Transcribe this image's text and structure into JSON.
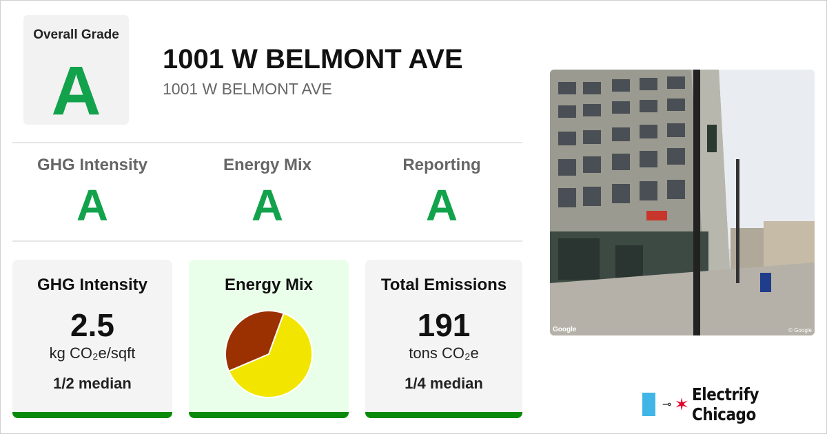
{
  "overall": {
    "label": "Overall Grade",
    "grade": "A"
  },
  "building": {
    "name": "1001 W BELMONT AVE",
    "address": "1001 W BELMONT AVE"
  },
  "subgrades": [
    {
      "label": "GHG Intensity",
      "grade": "A"
    },
    {
      "label": "Energy Mix",
      "grade": "A"
    },
    {
      "label": "Reporting",
      "grade": "A"
    }
  ],
  "cards": {
    "ghg": {
      "title": "GHG Intensity",
      "value": "2.5",
      "unit": "kg CO₂e/sqft",
      "median": "1/2 median"
    },
    "mix": {
      "title": "Energy Mix"
    },
    "emissions": {
      "title": "Total Emissions",
      "value": "191",
      "unit": "tons CO₂e",
      "median": "1/4 median"
    }
  },
  "chart_data": {
    "type": "pie",
    "title": "Energy Mix",
    "series": [
      {
        "value": 0.63,
        "color": "#f2e600"
      },
      {
        "value": 0.37,
        "color": "#9b3100"
      }
    ]
  },
  "photo": {
    "credit": "Google",
    "credit_right": "© Google"
  },
  "brand": {
    "name": "Electrify Chicago",
    "flag_color": "#41b6e6",
    "star_color": "#e4002b"
  },
  "colors": {
    "grade": "#12a24c",
    "bar": "#0a8a0a"
  }
}
